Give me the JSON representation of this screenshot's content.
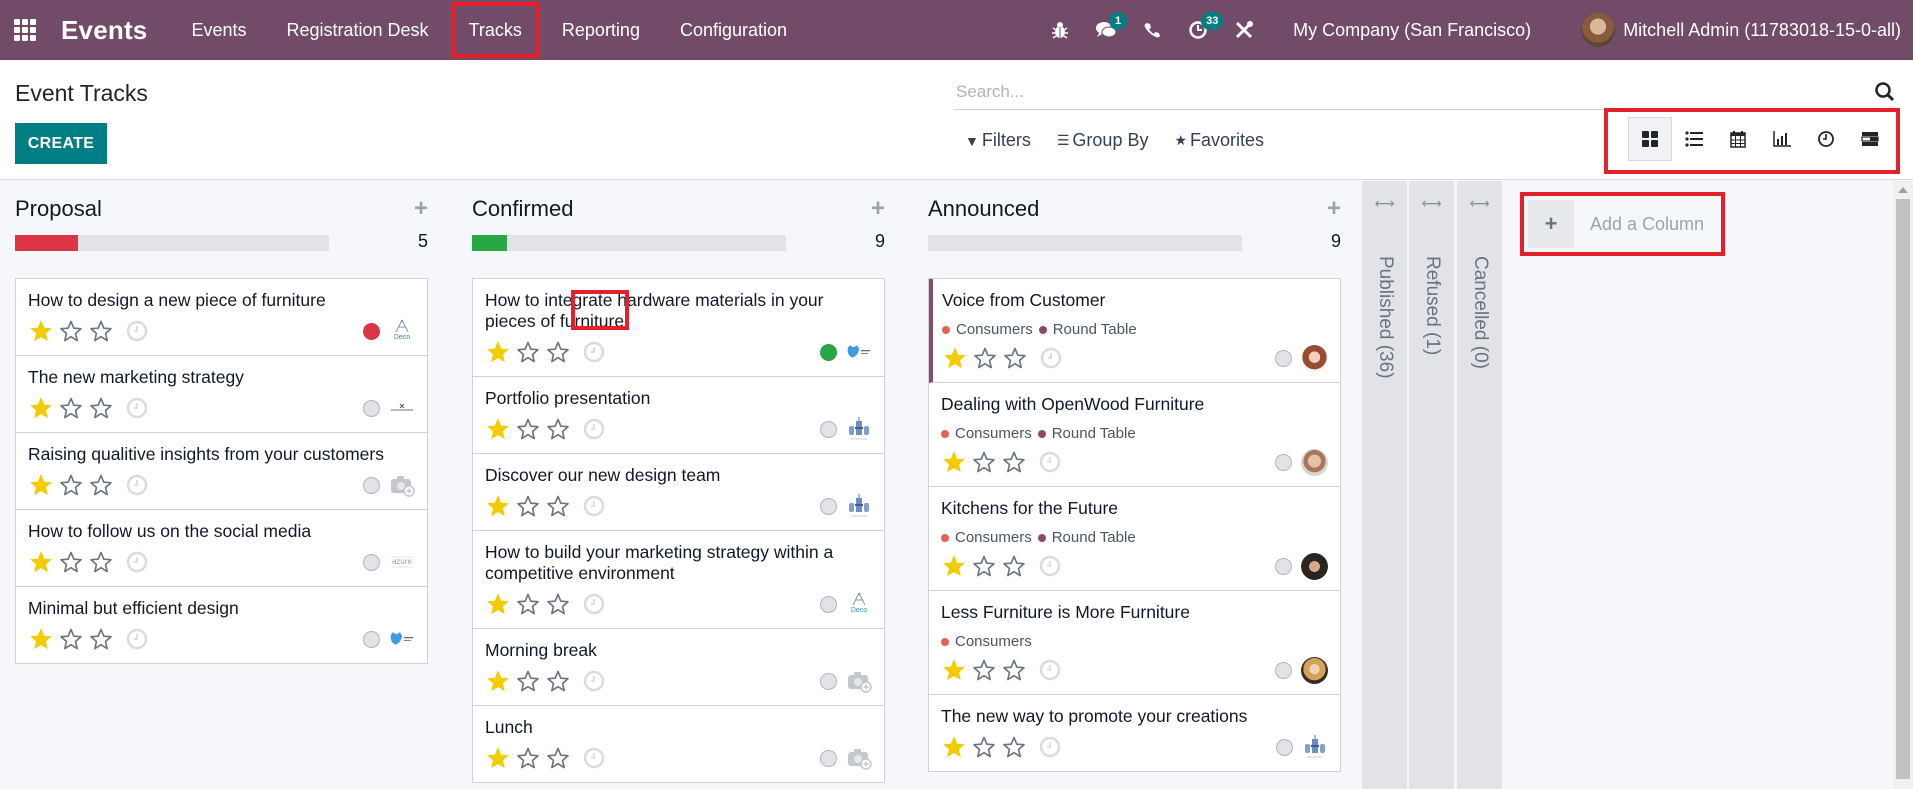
{
  "navbar": {
    "app_name": "Events",
    "menu": [
      "Events",
      "Registration Desk",
      "Tracks",
      "Reporting",
      "Configuration"
    ],
    "active_menu": "Tracks",
    "messages_badge": "1",
    "activities_badge": "33",
    "company": "My Company (San Francisco)",
    "user": "Mitchell Admin (11783018-15-0-all)",
    "accent_color": "#714b67"
  },
  "control_panel": {
    "title": "Event Tracks",
    "create_label": "CREATE",
    "search_placeholder": "Search...",
    "filters_label": "Filters",
    "group_by_label": "Group By",
    "favorites_label": "Favorites",
    "views": [
      "kanban",
      "list",
      "calendar",
      "graph",
      "activity",
      "gantt"
    ],
    "active_view": "kanban"
  },
  "columns": [
    {
      "title": "Proposal",
      "count": "5",
      "progress_fraction": 0.2,
      "progress_color": "#dc3545",
      "cards": [
        {
          "title": "How to design a new piece of furniture",
          "priority": 1,
          "state": "red",
          "logo": "deco-addict"
        },
        {
          "title": "The new marketing strategy",
          "priority": 1,
          "state": "grey",
          "logo": "wood-corner"
        },
        {
          "title": "Raising qualitive insights from your customers",
          "priority": 1,
          "state": "grey",
          "logo": "camera-placeholder"
        },
        {
          "title": "How to follow us on the social media",
          "priority": 1,
          "state": "grey",
          "logo": "azure"
        },
        {
          "title": "Minimal but efficient design",
          "priority": 1,
          "state": "grey",
          "logo": "gemini-furniture"
        }
      ]
    },
    {
      "title": "Confirmed",
      "count": "9",
      "progress_fraction": 0.11,
      "progress_color": "#28a745",
      "cards": [
        {
          "title": "How to integrate hardware materials in your pieces of furniture",
          "priority": 1,
          "state": "green",
          "logo": "gemini-furniture"
        },
        {
          "title": "Portfolio presentation",
          "priority": 1,
          "state": "grey",
          "logo": "ready-mat"
        },
        {
          "title": "Discover our new design team",
          "priority": 1,
          "state": "grey",
          "logo": "ready-mat"
        },
        {
          "title": "How to build your marketing strategy within a competitive environment",
          "priority": 1,
          "state": "grey",
          "logo": "deco-addict"
        },
        {
          "title": "Morning break",
          "priority": 1,
          "state": "grey",
          "logo": "camera-placeholder"
        },
        {
          "title": "Lunch",
          "priority": 1,
          "state": "grey",
          "logo": "camera-placeholder"
        }
      ]
    },
    {
      "title": "Announced",
      "count": "9",
      "progress_fraction": 0,
      "progress_color": "#28a745",
      "cards": [
        {
          "title": "Voice from Customer",
          "tags": [
            {
              "name": "Consumers",
              "color": "#e8634f"
            },
            {
              "name": "Round Table",
              "color": "#8b4a6b"
            }
          ],
          "priority": 1,
          "state": "grey",
          "avatar": "woman-red-hair",
          "accent": true
        },
        {
          "title": "Dealing with OpenWood Furniture",
          "tags": [
            {
              "name": "Consumers",
              "color": "#e8634f"
            },
            {
              "name": "Round Table",
              "color": "#8b4a6b"
            }
          ],
          "priority": 1,
          "state": "grey",
          "avatar": "bearded-man"
        },
        {
          "title": "Kitchens for the Future",
          "tags": [
            {
              "name": "Consumers",
              "color": "#e8634f"
            },
            {
              "name": "Round Table",
              "color": "#8b4a6b"
            }
          ],
          "priority": 1,
          "state": "grey",
          "avatar": "young-man"
        },
        {
          "title": "Less Furniture is More Furniture",
          "tags": [
            {
              "name": "Consumers",
              "color": "#e8634f"
            }
          ],
          "priority": 1,
          "state": "grey",
          "avatar": "blonde-woman"
        },
        {
          "title": "The new way to promote your creations",
          "priority": 1,
          "state": "grey",
          "logo": "ready-mat"
        }
      ]
    }
  ],
  "folded_columns": [
    "Published (36)",
    "Refused (1)",
    "Cancelled (0)"
  ],
  "add_column_label": "Add a Column"
}
